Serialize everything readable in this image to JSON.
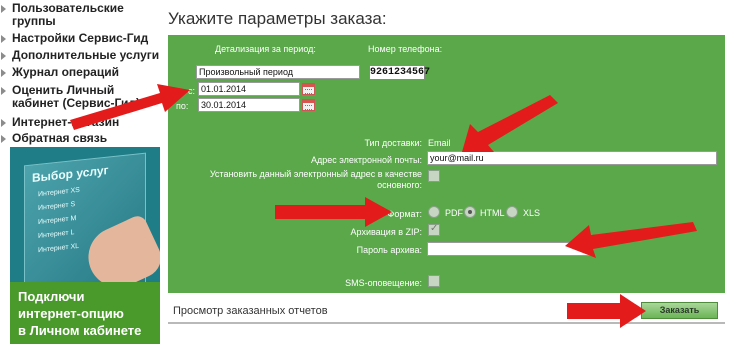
{
  "sidebar": {
    "items": [
      {
        "label": "Пользовательские группы"
      },
      {
        "label": "Настройки Сервис-Гид"
      },
      {
        "label": "Дополнительные услуги"
      },
      {
        "label": "Журнал операций"
      },
      {
        "label": "Оценить Личный кабинет (Сервис-Гид)"
      },
      {
        "label": "Интернет-магазин"
      },
      {
        "label": "Обратная связь"
      }
    ]
  },
  "banner": {
    "screen_title": "Выбор услуг",
    "screen_items": [
      "Интернет XS",
      "Интернет S",
      "Интернет M",
      "Интернет L",
      "Интернет XL"
    ],
    "promo": "Подключи\nинтернет-опцию\nв Личном кабинете"
  },
  "page": {
    "title": "Укажите параметры заказа:"
  },
  "form": {
    "period_label": "Детализация за период:",
    "phone_label": "Номер телефона:",
    "phone_value": "9261234567",
    "period_type": "Произвольный период",
    "date_from_prefix": "с:",
    "date_from": "01.01.2014",
    "date_to_prefix": "по:",
    "date_to": "30.01.2014",
    "delivery_label": "Тип доставки:",
    "delivery_value": "Email",
    "email_label": "Адрес электронной почты:",
    "email_value": "your@mail.ru",
    "default_label": "Установить данный электронный адрес в качестве основного:",
    "format_label": "Формат:",
    "format_options": [
      {
        "label": "PDF",
        "selected": false
      },
      {
        "label": "HTML",
        "selected": true
      },
      {
        "label": "XLS",
        "selected": false
      }
    ],
    "zip_label": "Архивация в ZIP:",
    "zip_checked": true,
    "password_label": "Пароль архива:",
    "password_value": "",
    "sms_label": "SMS-оповещение:"
  },
  "footer": {
    "reports_link": "Просмотр заказанных отчетов",
    "order_button": "Заказать"
  },
  "colors": {
    "panel": "#5aa84a",
    "arrow": "#e31b1b",
    "banner": "#1f7d88",
    "promo": "#4a9a2b"
  }
}
